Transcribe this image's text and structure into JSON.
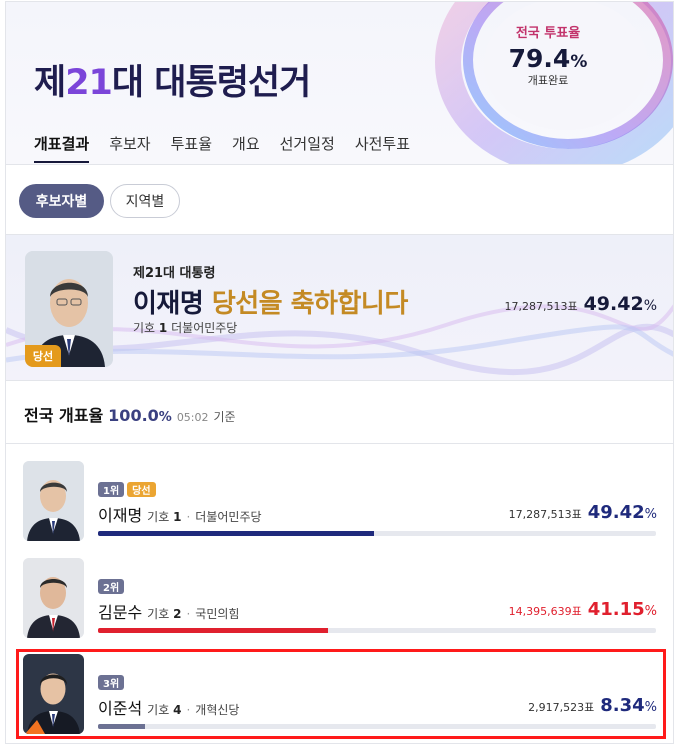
{
  "header": {
    "title_pre": "제",
    "title_num": "21",
    "title_post": "대 대통령선거",
    "turnout_label": "전국 투표율",
    "turnout_value": "79.4",
    "turnout_unit": "%",
    "turnout_sub": "개표완료"
  },
  "tabs": [
    "개표결과",
    "후보자",
    "투표율",
    "개요",
    "선거일정",
    "사전투표"
  ],
  "toggle": {
    "by_candidate": "후보자별",
    "by_region": "지역별"
  },
  "winner": {
    "badge": "당선",
    "subtitle": "제21대 대통령",
    "name": "이재명",
    "congrats": "당선을 축하합니다",
    "symbol_label": "기호",
    "symbol_num": "1",
    "party": "더불어민주당",
    "votes": "17,287,513표",
    "pct": "49.42",
    "pct_unit": "%"
  },
  "national": {
    "heading": "전국 개표율",
    "value": "100.0",
    "unit": "%",
    "time": "05:02",
    "basis": "기준"
  },
  "colors": {
    "accent_navy": "#1f2a7c",
    "accent_red": "#e0202e",
    "accent_orange": "#f27321",
    "badge_rank": "#6c7193",
    "badge_elect": "#eba532"
  },
  "candidates": [
    {
      "rank": "1위",
      "elect": "당선",
      "name": "이재명",
      "symbol_label": "기호",
      "symbol_num": "1",
      "sep": "·",
      "party": "더불어민주당",
      "votes": "17,287,513표",
      "pct": "49.42",
      "pct_unit": "%",
      "share": 0.4942,
      "votes_color": "#333333",
      "pct_color": "#1f2a7c",
      "bar_color": "#1f2a7c"
    },
    {
      "rank": "2위",
      "name": "김문수",
      "symbol_label": "기호",
      "symbol_num": "2",
      "sep": "·",
      "party": "국민의힘",
      "votes": "14,395,639표",
      "pct": "41.15",
      "pct_unit": "%",
      "share": 0.4115,
      "votes_color": "#e0202e",
      "pct_color": "#e0202e",
      "bar_color": "#e0202e"
    },
    {
      "rank": "3위",
      "name": "이준석",
      "symbol_label": "기호",
      "symbol_num": "4",
      "sep": "·",
      "party": "개혁신당",
      "votes": "2,917,523표",
      "pct": "8.34",
      "pct_unit": "%",
      "share": 0.0834,
      "votes_color": "#333333",
      "pct_color": "#1f2a7c",
      "bar_color": "#6c7193"
    }
  ]
}
